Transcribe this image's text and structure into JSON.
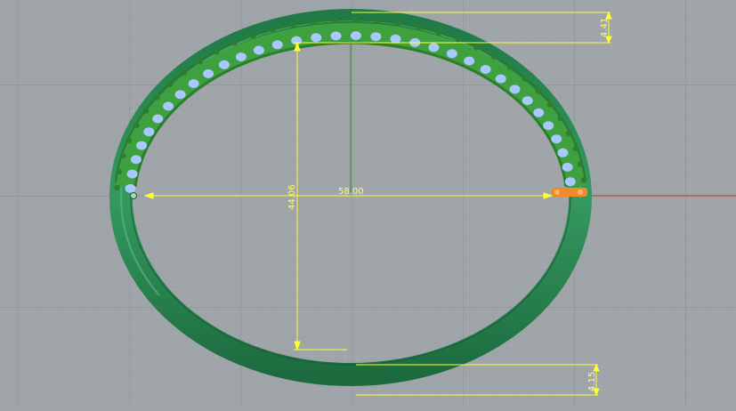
{
  "viewport": {
    "background": "#9ea4a8",
    "grid_minor_color": "#a9aeb2",
    "grid_major_color": "#8c9296",
    "x_axis_color": "#c0392b",
    "y_axis_color": "#2e8b2e"
  },
  "model": {
    "band_color": "#2a8a55",
    "band_highlight": "#4fb07a",
    "setting_color": "#3c9c3c",
    "stone_color": "#a9c8ff",
    "prong_color": "#2f7d2f",
    "hinge_color": "#f08a2a"
  },
  "dimensions": {
    "color": "#ffff33",
    "top_thickness": "4.41",
    "inner_height": "44.06",
    "inner_width": "58.00",
    "bottom_thickness": "4.15"
  }
}
